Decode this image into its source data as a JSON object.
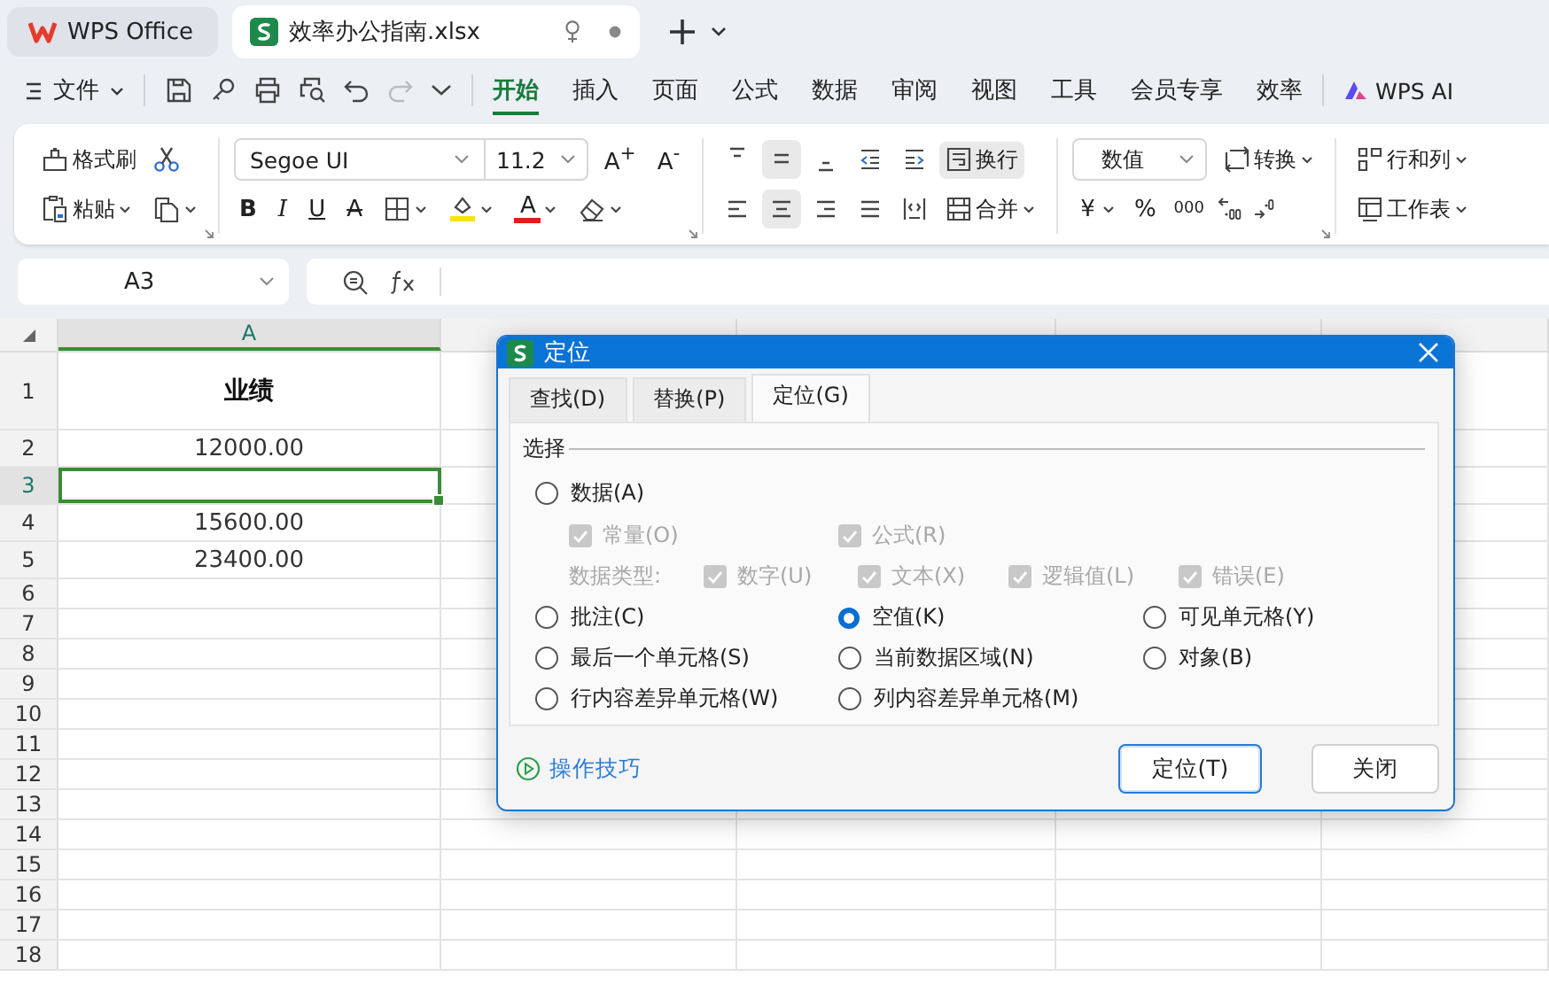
{
  "tabs": {
    "app": "WPS Office",
    "doc": {
      "title": "效率办公指南.xlsx",
      "selected": true
    }
  },
  "menu": {
    "file": "文件",
    "items": [
      {
        "label": "开始",
        "selected": true
      },
      {
        "label": "插入",
        "selected": false
      },
      {
        "label": "页面",
        "selected": false
      },
      {
        "label": "公式",
        "selected": false
      },
      {
        "label": "数据",
        "selected": false
      },
      {
        "label": "审阅",
        "selected": false
      },
      {
        "label": "视图",
        "selected": false
      },
      {
        "label": "工具",
        "selected": false
      },
      {
        "label": "会员专享",
        "selected": false
      },
      {
        "label": "效率",
        "selected": false
      }
    ],
    "ai": "WPS AI"
  },
  "ribbon": {
    "format_painter": "格式刷",
    "paste": "粘贴",
    "font": "Segoe UI",
    "font_size": "11.2",
    "grow_font": "A$^{+}$",
    "shrink_font": "A$^{-}$",
    "bold": "B",
    "italic": "I",
    "underline": "U",
    "strike": "A",
    "font_color": "A",
    "vertical_align": [
      {
        "selected": false
      },
      {
        "selected": true
      },
      {
        "selected": false
      }
    ],
    "horizontal_align": [
      {
        "selected": false
      },
      {
        "selected": true
      },
      {
        "selected": false
      },
      {
        "selected": false
      }
    ],
    "wrap": {
      "label": "换行",
      "on": true
    },
    "merge": "合并",
    "number_format": "数值",
    "convert": "转换",
    "currency": "¥",
    "percent": "%",
    "thousands": "000",
    "rows_cols": "行和列",
    "worksheet": "工作表"
  },
  "formula_bar": {
    "name_box": "A3"
  },
  "sheet": {
    "columns": [
      {
        "label": "A",
        "selected": true
      }
    ],
    "rows": [
      {
        "label": "1",
        "cell": "业绩",
        "kind": "header",
        "selected": false
      },
      {
        "label": "2",
        "cell": "12000.00",
        "kind": "value",
        "selected": false
      },
      {
        "label": "3",
        "kind": "value",
        "selected": true
      },
      {
        "label": "4",
        "cell": "15600.00",
        "kind": "value",
        "selected": false
      },
      {
        "label": "5",
        "cell": "23400.00",
        "kind": "value",
        "selected": false
      },
      {
        "label": "6",
        "kind": "empty",
        "selected": false
      },
      {
        "label": "7",
        "kind": "empty",
        "selected": false
      },
      {
        "label": "8",
        "kind": "empty",
        "selected": false
      },
      {
        "label": "9",
        "kind": "empty",
        "selected": false
      },
      {
        "label": "10",
        "kind": "empty",
        "selected": false
      },
      {
        "label": "11",
        "kind": "empty",
        "selected": false
      },
      {
        "label": "12",
        "kind": "empty",
        "selected": false
      },
      {
        "label": "13",
        "kind": "empty",
        "selected": false
      },
      {
        "label": "14",
        "kind": "empty",
        "selected": false
      },
      {
        "label": "15",
        "kind": "empty",
        "selected": false
      },
      {
        "label": "16",
        "kind": "empty",
        "selected": false
      },
      {
        "label": "17",
        "kind": "empty",
        "selected": false
      },
      {
        "label": "18",
        "kind": "empty",
        "selected": false
      }
    ]
  },
  "dialog": {
    "title": "定位",
    "tabs": [
      {
        "label": "查找(D)",
        "selected": false
      },
      {
        "label": "替换(P)",
        "selected": false
      },
      {
        "label": "定位(G)",
        "selected": true
      }
    ],
    "group": "选择",
    "data_option": {
      "label": "数据(A)",
      "selected": false
    },
    "data_sub": [
      {
        "label": "常量(O)",
        "checked": true,
        "disabled": true
      },
      {
        "label": "公式(R)",
        "checked": true,
        "disabled": true
      }
    ],
    "type_label": "数据类型:",
    "types": [
      {
        "label": "数字(U)",
        "checked": true,
        "disabled": true
      },
      {
        "label": "文本(X)",
        "checked": true,
        "disabled": true
      },
      {
        "label": "逻辑值(L)",
        "checked": true,
        "disabled": true
      },
      {
        "label": "错误(E)",
        "checked": true,
        "disabled": true
      }
    ],
    "options": [
      {
        "label": "批注(C)",
        "selected": false
      },
      {
        "label": "空值(K)",
        "selected": true
      },
      {
        "label": "可见单元格(Y)",
        "selected": false
      },
      {
        "label": "最后一个单元格(S)",
        "selected": false
      },
      {
        "label": "当前数据区域(N)",
        "selected": false
      },
      {
        "label": "对象(B)",
        "selected": false
      },
      {
        "label": "行内容差异单元格(W)",
        "selected": false
      },
      {
        "label": "列内容差异单元格(M)",
        "selected": false
      }
    ],
    "tips": "操作技巧",
    "buttons": [
      {
        "label": "定位(T)",
        "kind": "primary"
      },
      {
        "label": "关闭",
        "kind": "normal"
      }
    ]
  }
}
